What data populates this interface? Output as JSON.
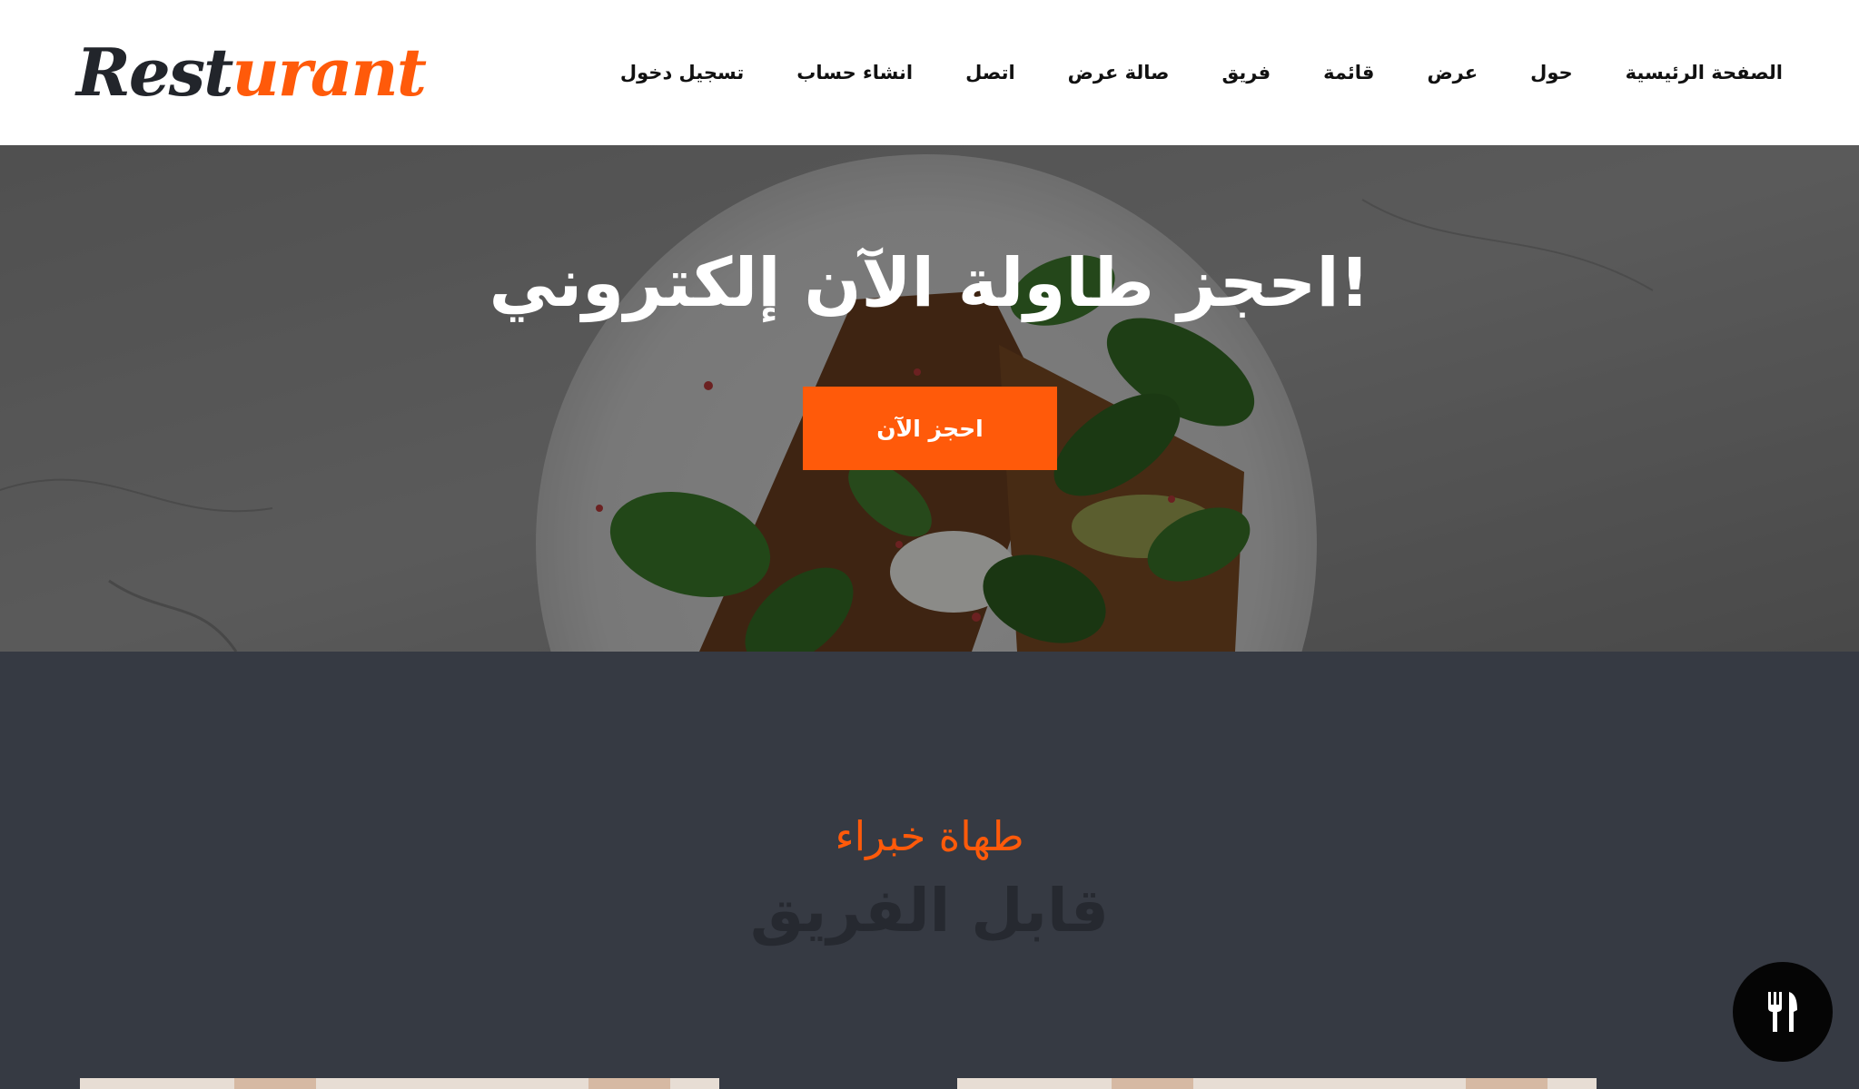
{
  "brand": {
    "logo_part1": "Rest",
    "logo_part2": "urant"
  },
  "nav": {
    "items": [
      {
        "label": "تسجيل دخول"
      },
      {
        "label": "انشاء حساب"
      },
      {
        "label": "اتصل"
      },
      {
        "label": "صالة عرض"
      },
      {
        "label": "فريق"
      },
      {
        "label": "قائمة"
      },
      {
        "label": "عرض"
      },
      {
        "label": "حول"
      },
      {
        "label": "الصفحة الرئيسية"
      }
    ]
  },
  "hero": {
    "title": "!احجز طاولة الآن إلكتروني",
    "button_label": "احجز الآن"
  },
  "team": {
    "subtitle": "طهاة خبراء",
    "title": "قابل الفريق"
  },
  "floating_button": {
    "icon": "utensils-icon"
  },
  "colors": {
    "accent": "#ff5a0a",
    "dark_section": "#363a43",
    "header_bg": "#ffffff"
  }
}
